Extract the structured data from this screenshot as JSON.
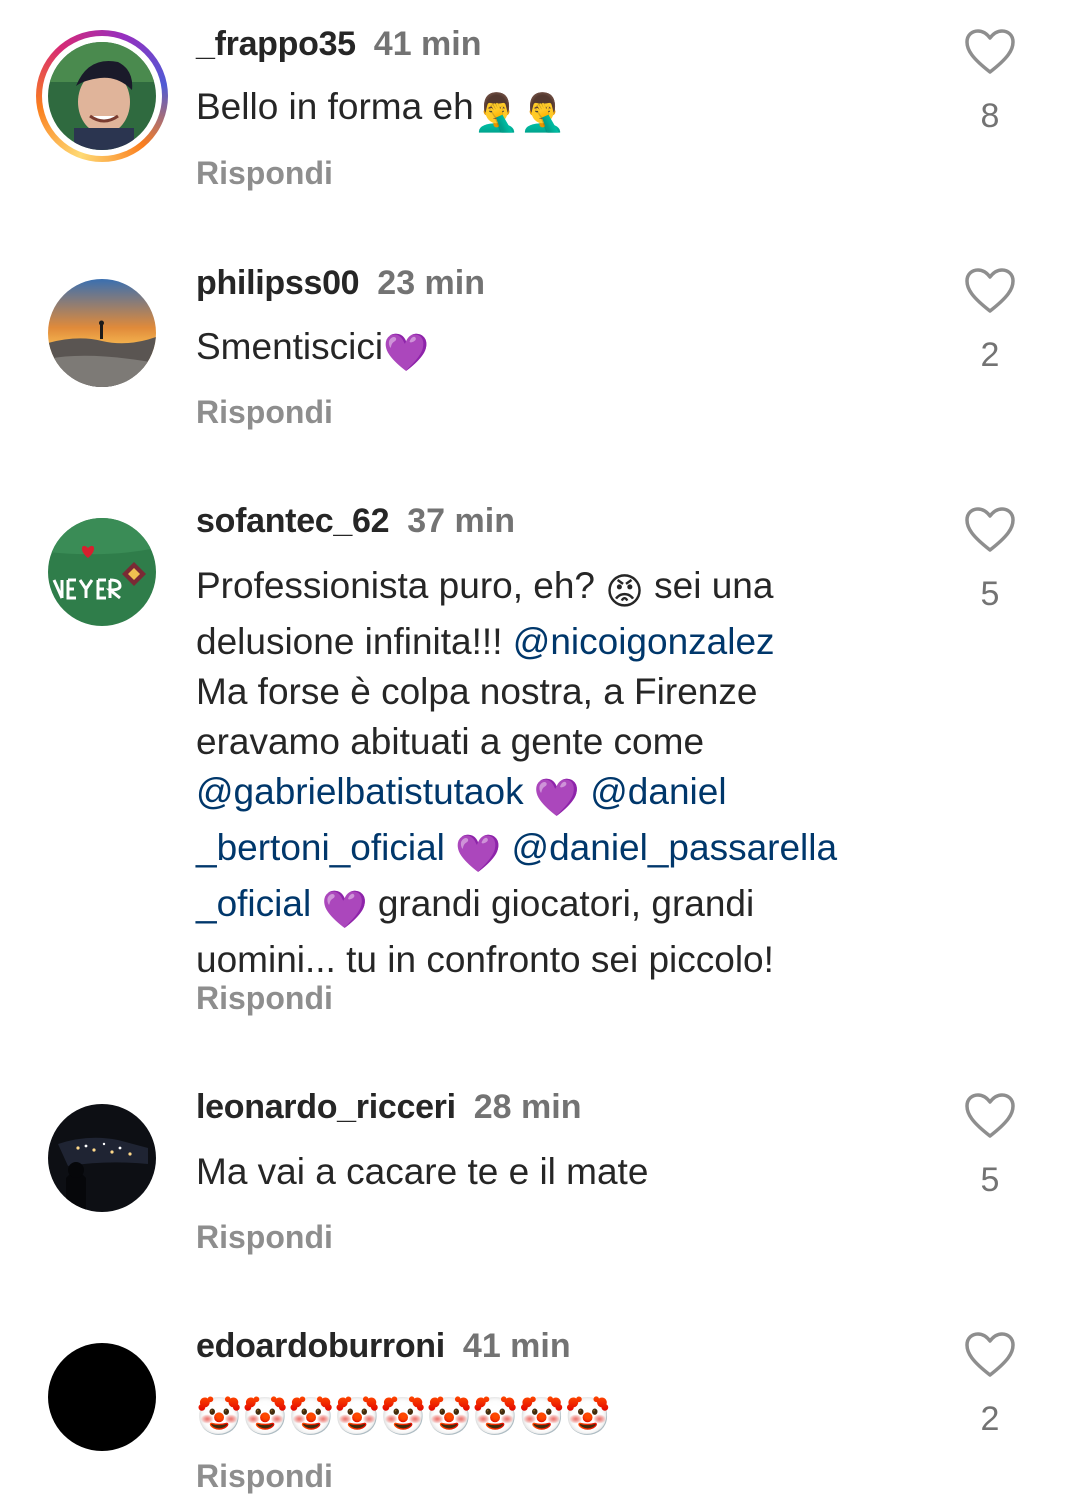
{
  "comments": [
    {
      "username": "_frappo35",
      "time": "41 min",
      "text": "Bello in forma eh",
      "emoji": "🤦‍♂️🤦‍♂️",
      "reply": "Rispondi",
      "likes": "8"
    },
    {
      "username": "philipss00",
      "time": "23 min",
      "text": "Smentiscici",
      "emoji": "💜",
      "reply": "Rispondi",
      "likes": "2"
    },
    {
      "username": "sofantec_62",
      "time": "37 min",
      "lines": {
        "l1a": "Professionista puro, eh? ",
        "l1emoji": "😡",
        "l1b": " sei una",
        "l2a": "delusione infinita!!! ",
        "l2mention": "@nicoigonzalez",
        "l3": "Ma forse è colpa nostra,  a Firenze",
        "l4": "eravamo abituati a gente come",
        "l5mention": "@gabrielbatistutaok",
        "l5emoji": "💜",
        "l5mention2": "@daniel",
        "l6mention": "_bertoni_oficial",
        "l6emoji": "💜",
        "l6mention2": "@daniel_passarella",
        "l7mention": "_oficial",
        "l7emoji": "💜",
        "l7b": " grandi giocatori, grandi",
        "l8": "uomini... tu in confronto sei piccolo!"
      },
      "reply": "Rispondi",
      "likes": "5"
    },
    {
      "username": "leonardo_ricceri",
      "time": "28 min",
      "text": "Ma vai a cacare te e il mate",
      "reply": "Rispondi",
      "likes": "5"
    },
    {
      "username": "edoardoburroni",
      "time": "41 min",
      "emoji": "🤡🤡🤡🤡🤡🤡🤡🤡🤡",
      "reply": "Rispondi",
      "likes": "2"
    }
  ],
  "icons": {
    "like": "heart-outline-icon"
  },
  "colors": {
    "mention": "#00376b",
    "muted": "#737373",
    "text": "#262626"
  }
}
